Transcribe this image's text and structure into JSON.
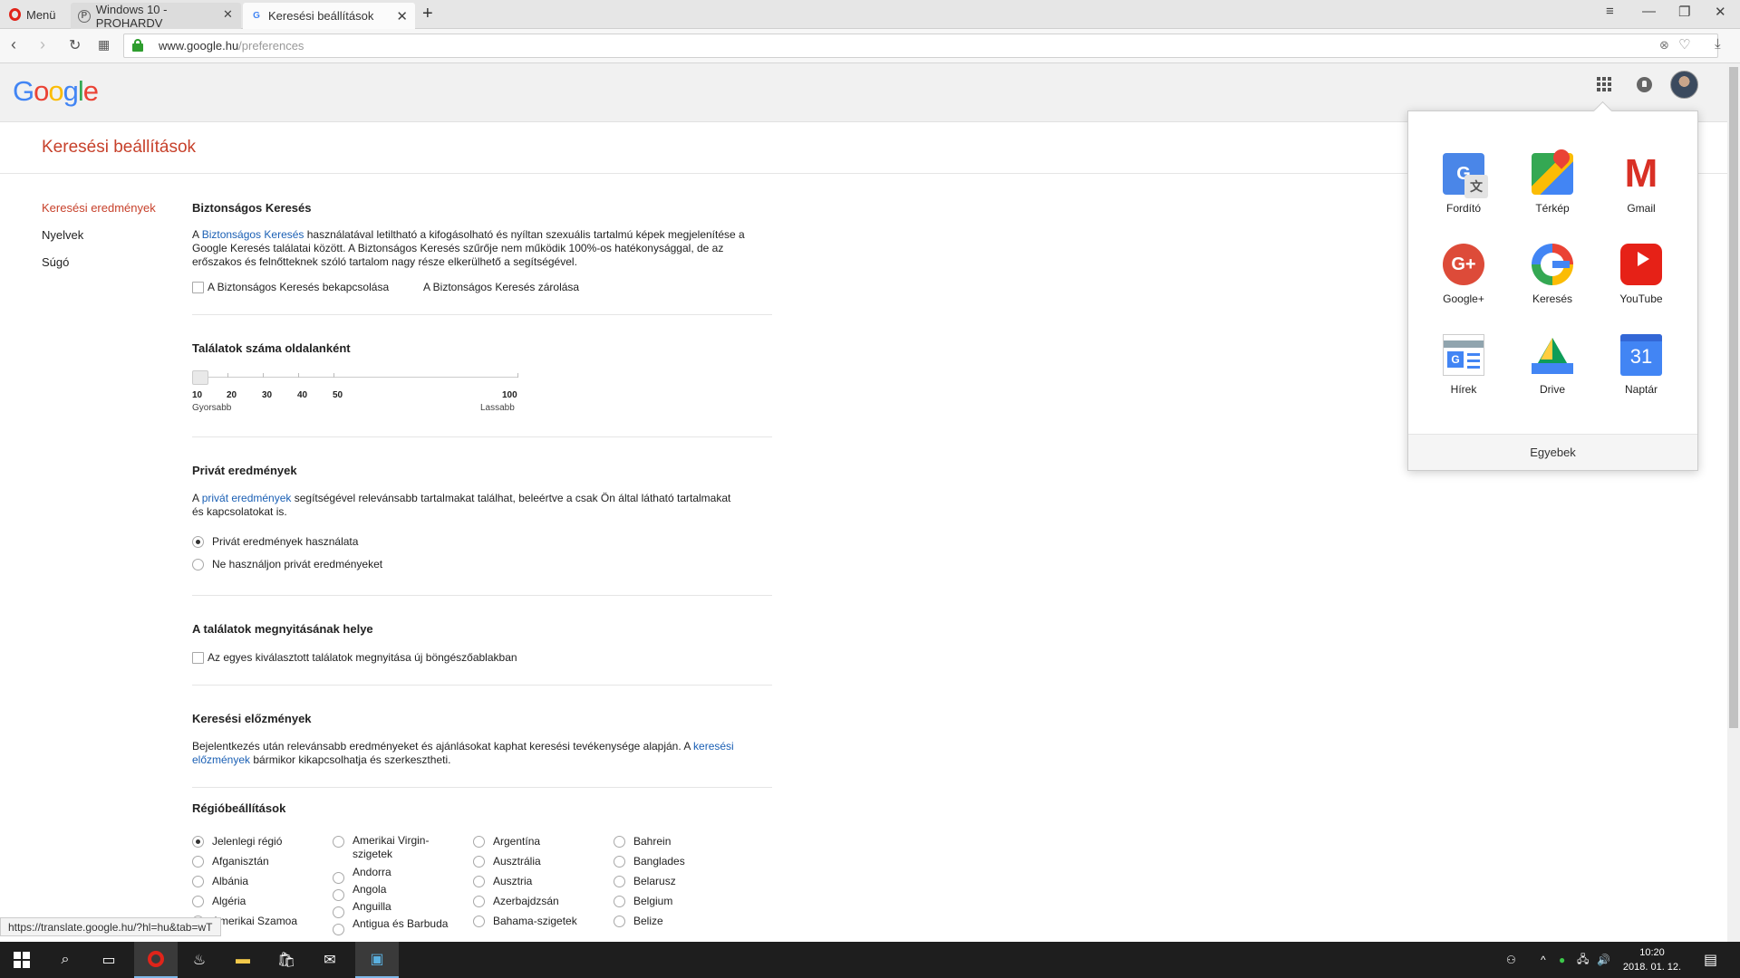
{
  "browser": {
    "menu_label": "Menü",
    "tabs": [
      {
        "title": "Windows 10 - PROHARDV"
      },
      {
        "title": "Keresési beállítások"
      }
    ],
    "url_host": "www.google.hu",
    "url_path": "/preferences",
    "status_url": "https://translate.google.hu/?hl=hu&tab=wT"
  },
  "page": {
    "title": "Keresési beállítások"
  },
  "sidebar": {
    "items": [
      {
        "label": "Keresési eredmények",
        "active": true
      },
      {
        "label": "Nyelvek"
      },
      {
        "label": "Súgó"
      }
    ]
  },
  "safesearch": {
    "title": "Biztonságos Keresés",
    "p1": "A ",
    "link": "Biztonságos Keresés",
    "p2": " használatával letiltható a kifogásolható és nyíltan szexuális tartalmú képek megjelenítése a Google Keresés találatai között. A Biztonságos Keresés szűrője nem működik 100%-os hatékonysággal, de az erőszakos és felnőtteknek szóló tartalom nagy része elkerülhető a segítségével.",
    "checkbox_label": "A Biztonságos Keresés bekapcsolása",
    "lock_link": "A Biztonságos Keresés zárolása"
  },
  "results_per_page": {
    "title": "Találatok száma oldalanként",
    "ticks": [
      "10",
      "20",
      "30",
      "40",
      "50",
      "100"
    ],
    "faster": "Gyorsabb",
    "slower": "Lassabb",
    "value": 10
  },
  "private": {
    "title": "Privát eredmények",
    "p1": "A ",
    "link": "privát eredmények",
    "p2": " segítségével relevánsabb tartalmakat találhat, beleértve a csak Ön által látható tartalmakat és kapcsolatokat is.",
    "opt_use": "Privát eredmények használata",
    "opt_no": "Ne használjon privát eredményeket"
  },
  "open_results": {
    "title": "A találatok megnyitásának helye",
    "checkbox_label": "Az egyes kiválasztott találatok megnyitása új böngészőablakban"
  },
  "history": {
    "title": "Keresési előzmények",
    "p1": "Bejelentkezés után relevánsabb eredményeket és ajánlásokat kaphat keresési tevékenysége alapján. A ",
    "link": "keresési előzmények",
    "p2": " bármikor kikapcsolhatja és szerkesztheti."
  },
  "region": {
    "title": "Régióbeállítások",
    "columns": [
      [
        "Jelenlegi régió",
        "Afganisztán",
        "Albánia",
        "Algéria",
        "Amerikai Szamoa"
      ],
      [
        "Amerikai Virgin-szigetek",
        "Andorra",
        "Angola",
        "Anguilla",
        "Antigua és Barbuda"
      ],
      [
        "Argentína",
        "Ausztrália",
        "Ausztria",
        "Azerbajdzsán",
        "Bahama-szigetek"
      ],
      [
        "Bahrein",
        "Banglades",
        "Belarusz",
        "Belgium",
        "Belize"
      ]
    ]
  },
  "apps": {
    "items": [
      {
        "name": "Fordító",
        "icon": "translate-icon"
      },
      {
        "name": "Térkép",
        "icon": "maps-icon"
      },
      {
        "name": "Gmail",
        "icon": "gmail-icon"
      },
      {
        "name": "Google+",
        "icon": "google-plus-icon"
      },
      {
        "name": "Keresés",
        "icon": "google-search-icon"
      },
      {
        "name": "YouTube",
        "icon": "youtube-icon"
      },
      {
        "name": "Hírek",
        "icon": "news-icon"
      },
      {
        "name": "Drive",
        "icon": "drive-icon"
      },
      {
        "name": "Naptár",
        "icon": "calendar-icon"
      }
    ],
    "more": "Egyebek",
    "calendar_day": "31"
  },
  "taskbar": {
    "time": "10:20",
    "date": "2018. 01. 12."
  }
}
